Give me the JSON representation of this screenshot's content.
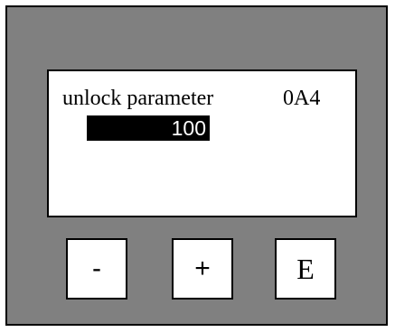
{
  "display": {
    "parameter_label": "unlock parameter",
    "parameter_code": "0A4",
    "value": "100"
  },
  "keys": {
    "minus_label": "-",
    "plus_label": "+",
    "enter_label": "E"
  },
  "colors": {
    "panel": "#808080",
    "screen": "#ffffff",
    "value_highlight": "#000000",
    "value_text": "#ffffff"
  }
}
